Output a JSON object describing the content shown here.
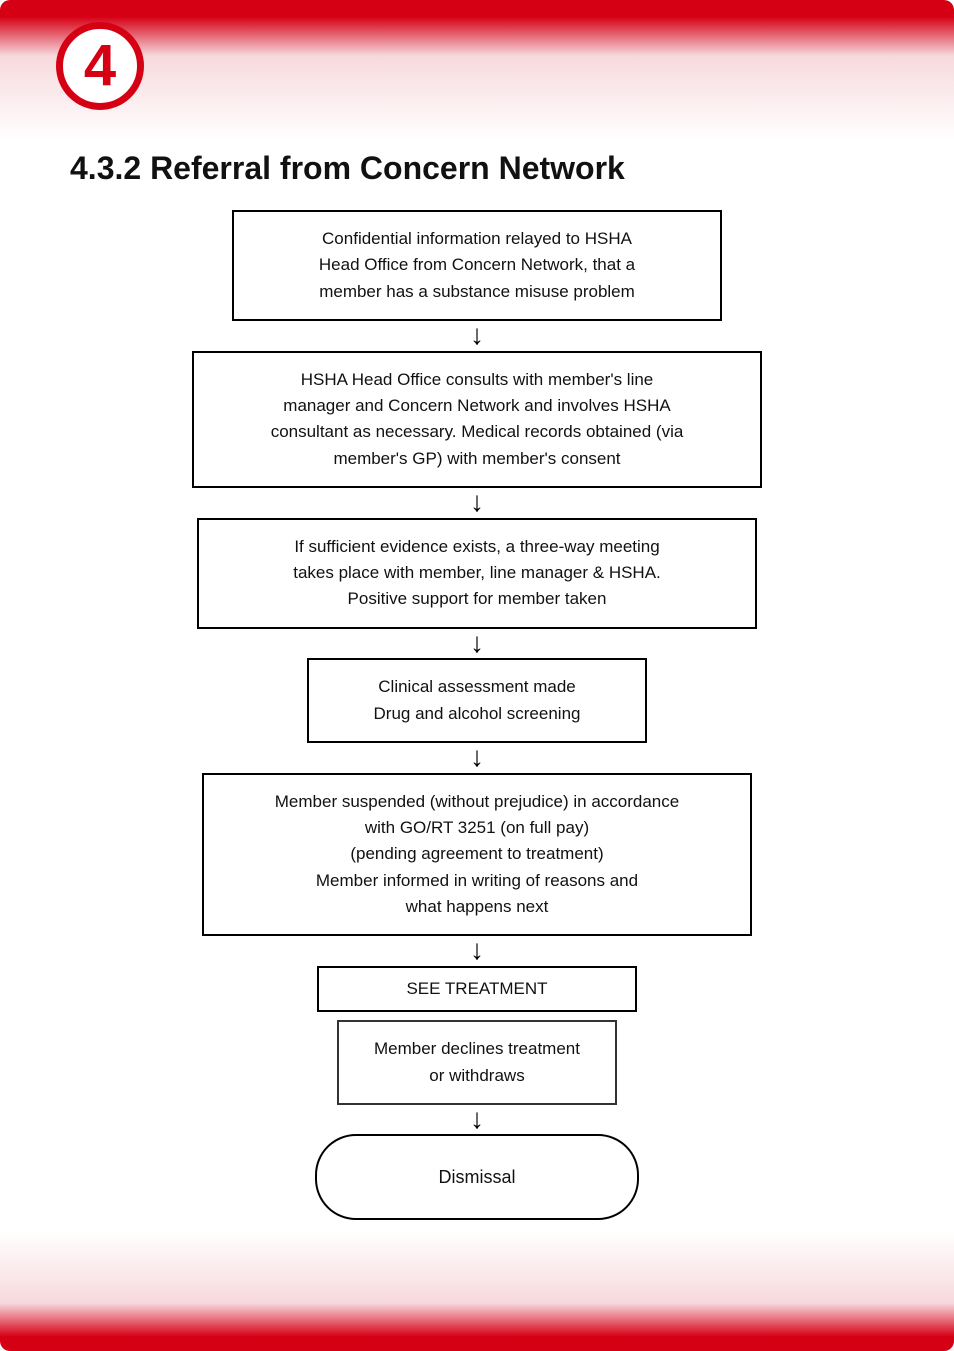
{
  "badge": {
    "number": "4"
  },
  "heading": "4.3.2 Referral from Concern Network",
  "flow": {
    "step1": "Confidential information relayed to HSHA\nHead Office from Concern Network, that a\nmember has a substance misuse problem",
    "step2": "HSHA Head Office consults with member's line\nmanager and Concern Network and involves HSHA\nconsultant as necessary.  Medical records obtained (via\nmember's GP) with member's consent",
    "step3": "If sufficient evidence exists, a three-way meeting\ntakes place with member, line manager & HSHA.\nPositive support for member taken",
    "step4": "Clinical assessment made\nDrug and alcohol screening",
    "step5": "Member suspended (without prejudice) in accordance\nwith GO/RT 3251 (on full pay)\n(pending agreement to treatment)\nMember informed in writing of reasons and\nwhat happens next",
    "step6": "SEE TREATMENT",
    "step7": "Member declines treatment\nor withdraws",
    "step8": "Dismissal"
  }
}
